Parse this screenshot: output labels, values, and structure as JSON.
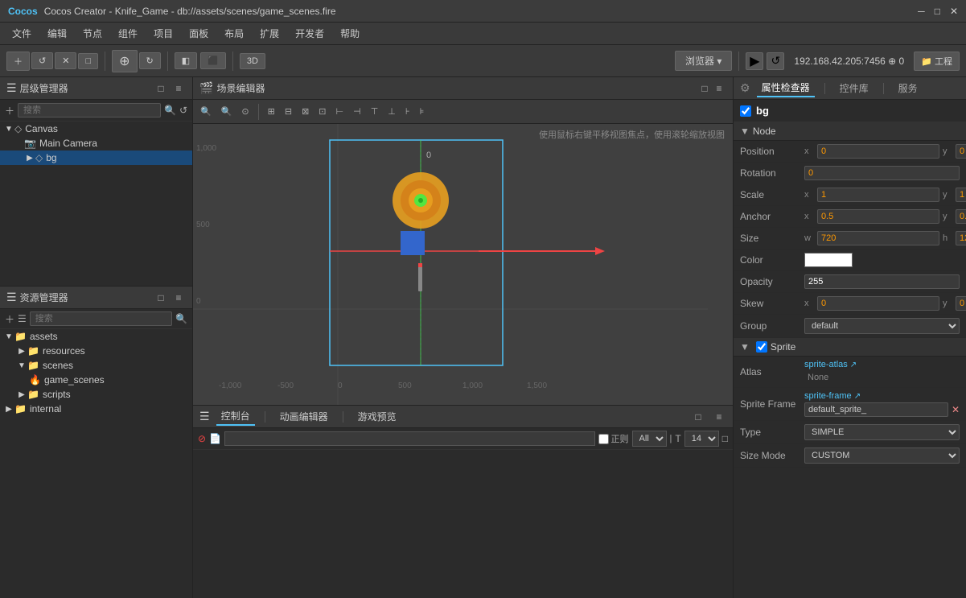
{
  "titleBar": {
    "title": "Cocos Creator - Knife_Game - db://assets/scenes/game_scenes.fire"
  },
  "menuBar": {
    "items": [
      "文件",
      "编辑",
      "节点",
      "组件",
      "项目",
      "面板",
      "布局",
      "扩展",
      "开发者",
      "帮助"
    ]
  },
  "toolbar": {
    "buttons": [
      "＋",
      "↺",
      "✕",
      "□",
      "≡",
      "⊕"
    ],
    "browser": "浏览器 ▾",
    "play": "▶",
    "refresh": "↺",
    "ip": "192.168.42.205:7456 ⊕ 0",
    "folder": "工程"
  },
  "hierarchy": {
    "title": "层级管理器",
    "searchPlaceholder": "搜索",
    "nodes": [
      {
        "label": "Canvas",
        "type": "canvas",
        "indent": 0,
        "expanded": true
      },
      {
        "label": "Main Camera",
        "type": "camera",
        "indent": 1
      },
      {
        "label": "bg",
        "type": "bg",
        "indent": 1,
        "selected": true
      }
    ]
  },
  "sceneEditor": {
    "title": "场景编辑器",
    "tip": "使用鼠标右键平移视图焦点，使用滚轮缩放视图",
    "coords": {
      "zero": "0",
      "y1000": "1,000",
      "y500": "500",
      "y0": "0",
      "xNeg1000": "-1,000",
      "xNeg500": "-500",
      "x0": "0",
      "x500": "500",
      "x1000": "1,000",
      "x1500": "1,500"
    }
  },
  "bottomPanel": {
    "tabs": [
      "控制台",
      "动画编辑器",
      "游戏预览"
    ],
    "activeTab": 0,
    "console": {
      "regexLabel": "正则",
      "filterAll": "All",
      "fontSize": "14"
    }
  },
  "assets": {
    "title": "资源管理器",
    "searchPlaceholder": "搜索",
    "tree": [
      {
        "label": "assets",
        "type": "folder",
        "indent": 0,
        "expanded": true
      },
      {
        "label": "resources",
        "type": "folder",
        "indent": 1,
        "expanded": false
      },
      {
        "label": "scenes",
        "type": "folder",
        "indent": 1,
        "expanded": true
      },
      {
        "label": "game_scenes",
        "type": "scene",
        "indent": 2
      },
      {
        "label": "scripts",
        "type": "folder",
        "indent": 1,
        "expanded": false
      },
      {
        "label": "internal",
        "type": "folder",
        "indent": 0,
        "expanded": false
      }
    ]
  },
  "properties": {
    "title": "属性检查器",
    "tabs": [
      "属性检查器",
      "控件库",
      "服务"
    ],
    "nodeName": "bg",
    "nodeChecked": true,
    "sections": {
      "node": {
        "title": "Node",
        "position": {
          "x": "0",
          "y": "0"
        },
        "rotation": "0",
        "scale": {
          "x": "1",
          "y": "1"
        },
        "anchor": {
          "x": "0.5",
          "y": "0."
        },
        "size": {
          "w": "720",
          "h": "12"
        },
        "color": "#ffffff",
        "opacity": "255",
        "skew": {
          "x": "0",
          "y": "0"
        },
        "group": "default"
      },
      "sprite": {
        "title": "Sprite",
        "checked": true,
        "atlas": {
          "linkText": "sprite-atlas",
          "value": "None"
        },
        "spriteFrame": {
          "linkText": "sprite-frame",
          "value": "default_sprite_",
          "hasX": true
        },
        "type": "SIMPLE",
        "sizeMode": "CUSTOM"
      }
    }
  }
}
